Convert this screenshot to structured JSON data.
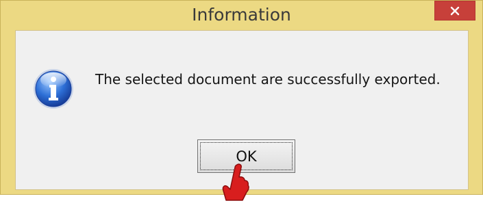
{
  "window": {
    "title": "Information",
    "close_glyph": "✕"
  },
  "dialog": {
    "message": "The selected document are successfully exported.",
    "icon": "information-icon",
    "ok_label": "OK"
  },
  "annotation": {
    "icon": "red-hand-pointer-icon"
  },
  "colors": {
    "titlebar": "#ecd983",
    "close_button": "#c7403a",
    "client_area": "#f0f0f0",
    "pointer": "#d81e1e"
  }
}
